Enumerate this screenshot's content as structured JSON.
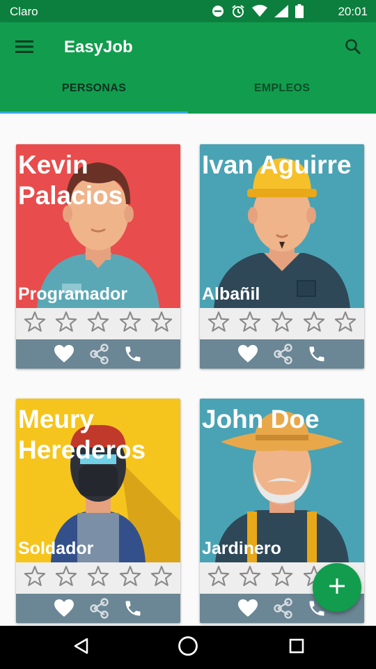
{
  "status_bar": {
    "carrier": "Claro",
    "time": "20:01",
    "icons": [
      "do-not-disturb-icon",
      "alarm-icon",
      "wifi-icon",
      "signal-icon",
      "battery-icon"
    ]
  },
  "app_bar": {
    "title": "EasyJob",
    "menu_icon": "menu-icon",
    "search_icon": "search-icon"
  },
  "tabs": [
    {
      "label": "PERSONAS",
      "selected": true
    },
    {
      "label": "EMPLEOS",
      "selected": false
    }
  ],
  "colors": {
    "primary": "#119d4d",
    "primary_dark": "#0c7f3e",
    "tab_indicator": "#37a8e0",
    "actions_bar": "#6b8694"
  },
  "people": [
    {
      "name": "Kevin Palacios",
      "job": "Programador",
      "background": "#e84c4c",
      "rating": 0
    },
    {
      "name": "Ivan Aguirre",
      "job": "Albañil",
      "background": "#4aa3b4",
      "rating": 0
    },
    {
      "name": "Meury Herederos",
      "job": "Soldador",
      "background": "#f5c51e",
      "rating": 0
    },
    {
      "name": "John Doe",
      "job": "Jardinero",
      "background": "#4aa3b4",
      "rating": 0
    }
  ],
  "card_actions": [
    "heart-icon",
    "share-icon",
    "phone-icon"
  ],
  "fab": {
    "icon": "plus-icon"
  },
  "nav_bar": [
    "back-icon",
    "home-icon",
    "recents-icon"
  ]
}
